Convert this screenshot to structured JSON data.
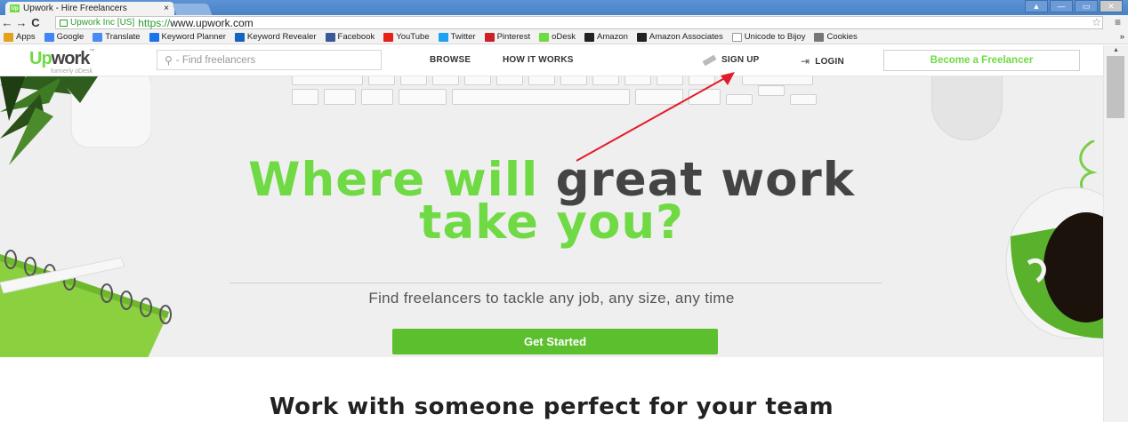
{
  "browser": {
    "tab_title": "Upwork - Hire Freelancers",
    "tab_close": "×",
    "tab_favicon": "Up",
    "site_identity": "Upwork Inc [US]",
    "url_scheme": "https://",
    "url_host": "www.upwork.com",
    "back": "←",
    "forward": "→",
    "reload": "C",
    "star": "☆",
    "menu": "≡",
    "bookmarks": [
      {
        "label": "Apps",
        "icon": "apps-icon",
        "color": "#e4a11b"
      },
      {
        "label": "Google",
        "icon": "google-icon",
        "color": "#4285f4"
      },
      {
        "label": "Translate",
        "icon": "translate-icon",
        "color": "#4a8af4"
      },
      {
        "label": "Keyword Planner",
        "icon": "keyword-planner-icon",
        "color": "#1a73e8"
      },
      {
        "label": "Keyword Revealer",
        "icon": "keyword-revealer-icon",
        "color": "#1565c0"
      },
      {
        "label": "Facebook",
        "icon": "facebook-icon",
        "color": "#3b5998"
      },
      {
        "label": "YouTube",
        "icon": "youtube-icon",
        "color": "#e62117"
      },
      {
        "label": "Twitter",
        "icon": "twitter-icon",
        "color": "#1da1f2"
      },
      {
        "label": "Pinterest",
        "icon": "pinterest-icon",
        "color": "#cb2027"
      },
      {
        "label": "oDesk",
        "icon": "odesk-icon",
        "color": "#6fda44"
      },
      {
        "label": "Amazon",
        "icon": "amazon-icon",
        "color": "#222222"
      },
      {
        "label": "Amazon Associates",
        "icon": "amazon-associates-icon",
        "color": "#222222"
      },
      {
        "label": "Unicode to Bijoy",
        "icon": "page-icon",
        "color": "#ffffff"
      },
      {
        "label": "Cookies",
        "icon": "gear-icon",
        "color": "#777777"
      }
    ],
    "bookmarks_more": "»"
  },
  "nav": {
    "logo_up": "Up",
    "logo_work": "work",
    "logo_tm": "™",
    "logo_formerly": "formerly oDesk",
    "search_placeholder": "Find freelancers",
    "browse": "BROWSE",
    "how_it_works": "HOW IT WORKS",
    "signup": "SIGN UP",
    "login": "LOGIN",
    "become_freelancer": "Become a Freelancer"
  },
  "hero": {
    "headline_green_1": "Where will",
    "headline_dark_1": "great work",
    "headline_green_2": "take you?",
    "subtitle": "Find freelancers to tackle any job, any size, any time",
    "cta": "Get Started"
  },
  "section": {
    "title": "Work with someone perfect for your team"
  },
  "colors": {
    "brand_green": "#6fda44",
    "cta_green": "#5cbf2e",
    "annotation_red": "#e11d2a"
  }
}
